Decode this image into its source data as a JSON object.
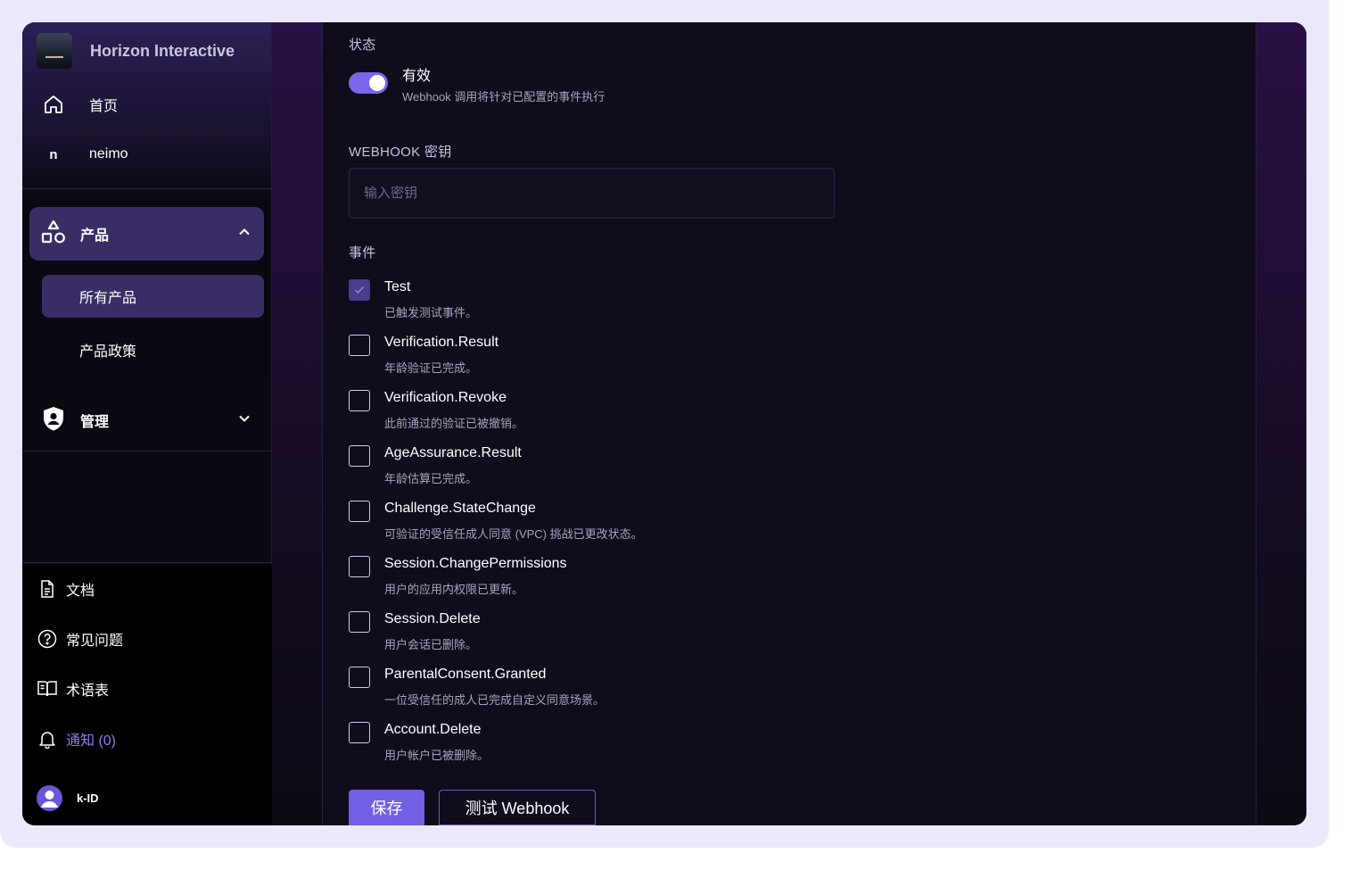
{
  "brand": {
    "name": "Horizon Interactive",
    "logo_icon": "horizon-logo"
  },
  "sidebar": {
    "top_items": [
      {
        "label": "首页",
        "icon": "home-icon"
      },
      {
        "label": "neimo",
        "icon_letter": "n"
      }
    ],
    "products_group": {
      "label": "产品",
      "icon": "shapes-icon",
      "expanded": true,
      "items": [
        {
          "label": "所有产品",
          "active": true
        },
        {
          "label": "产品政策",
          "active": false
        }
      ]
    },
    "admin_group": {
      "label": "管理",
      "icon": "shield-icon",
      "expanded": false
    },
    "bottom_items": [
      {
        "label": "文档",
        "icon": "document-icon"
      },
      {
        "label": "常见问题",
        "icon": "help-circle-icon"
      },
      {
        "label": "术语表",
        "icon": "book-open-icon"
      },
      {
        "label": "通知 (0)",
        "icon": "bell-icon"
      }
    ],
    "user": {
      "name": "k-ID"
    }
  },
  "form": {
    "status_label": "状态",
    "status_toggle": {
      "on": true,
      "title": "有效",
      "description": "Webhook 调用将针对已配置的事件执行"
    },
    "secret_label": "WEBHOOK 密钥",
    "secret_placeholder": "输入密钥",
    "secret_value": "",
    "events_label": "事件",
    "events": [
      {
        "name": "Test",
        "description": "已触发测试事件。",
        "checked": true
      },
      {
        "name": "Verification.Result",
        "description": "年龄验证已完成。",
        "checked": false
      },
      {
        "name": "Verification.Revoke",
        "description": "此前通过的验证已被撤销。",
        "checked": false
      },
      {
        "name": "AgeAssurance.Result",
        "description": "年龄估算已完成。",
        "checked": false
      },
      {
        "name": "Challenge.StateChange",
        "description": "可验证的受信任成人同意 (VPC) 挑战已更改状态。",
        "checked": false
      },
      {
        "name": "Session.ChangePermissions",
        "description": "用户的应用内权限已更新。",
        "checked": false
      },
      {
        "name": "Session.Delete",
        "description": "用户会话已删除。",
        "checked": false
      },
      {
        "name": "ParentalConsent.Granted",
        "description": "一位受信任的成人已完成自定义同意场景。",
        "checked": false
      },
      {
        "name": "Account.Delete",
        "description": "用户帐户已被删除。",
        "checked": false
      }
    ],
    "save_label": "保存",
    "test_label": "测试 Webhook"
  },
  "colors": {
    "accent": "#7060e4",
    "active_bg": "#3a2d66",
    "notify_text": "#8f7cf0"
  }
}
